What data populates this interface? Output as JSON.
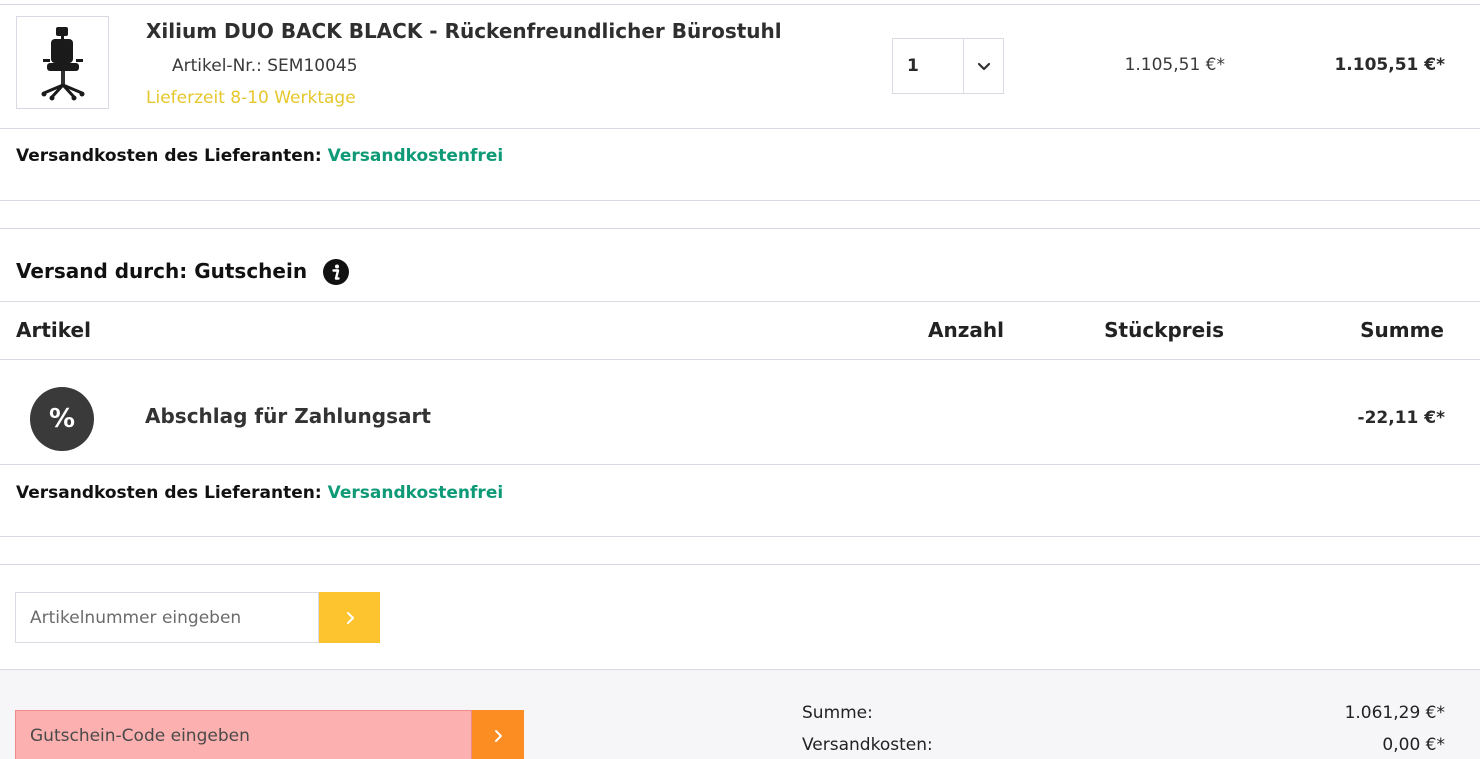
{
  "product": {
    "title": "Xilium DUO BACK BLACK - Rückenfreundlicher Bürostuhl",
    "sku": "Artikel-Nr.: SEM10045",
    "delivery": "Lieferzeit 8-10 Werktage",
    "quantity": "1",
    "unit_price": "1.105,51 €*",
    "sum": "1.105,51 €*"
  },
  "shipping1": {
    "label": "Versandkosten des Lieferanten:",
    "value": "Versandkostenfrei"
  },
  "section": {
    "title": "Versand durch: Gutschein"
  },
  "table_headers": {
    "article": "Artikel",
    "quantity": "Anzahl",
    "unit_price": "Stückpreis",
    "sum": "Summe"
  },
  "discount": {
    "badge": "%",
    "title": "Abschlag für Zahlungsart",
    "sum": "-22,11 €*"
  },
  "shipping2": {
    "label": "Versandkosten des Lieferanten:",
    "value": "Versandkostenfrei"
  },
  "article_input": {
    "placeholder": "Artikelnummer eingeben",
    "button": "›"
  },
  "voucher_input": {
    "placeholder": "Gutschein-Code eingeben",
    "button": "›"
  },
  "totals": {
    "sum_label": "Summe:",
    "sum_value": "1.061,29 €*",
    "shipping_label": "Versandkosten:",
    "shipping_value": "0,00 €*"
  },
  "colors": {
    "accent_yellow": "#fdc42f",
    "accent_orange": "#fc8d23",
    "free_green": "#0e9a77",
    "delivery_yellow": "#e6c72d"
  }
}
